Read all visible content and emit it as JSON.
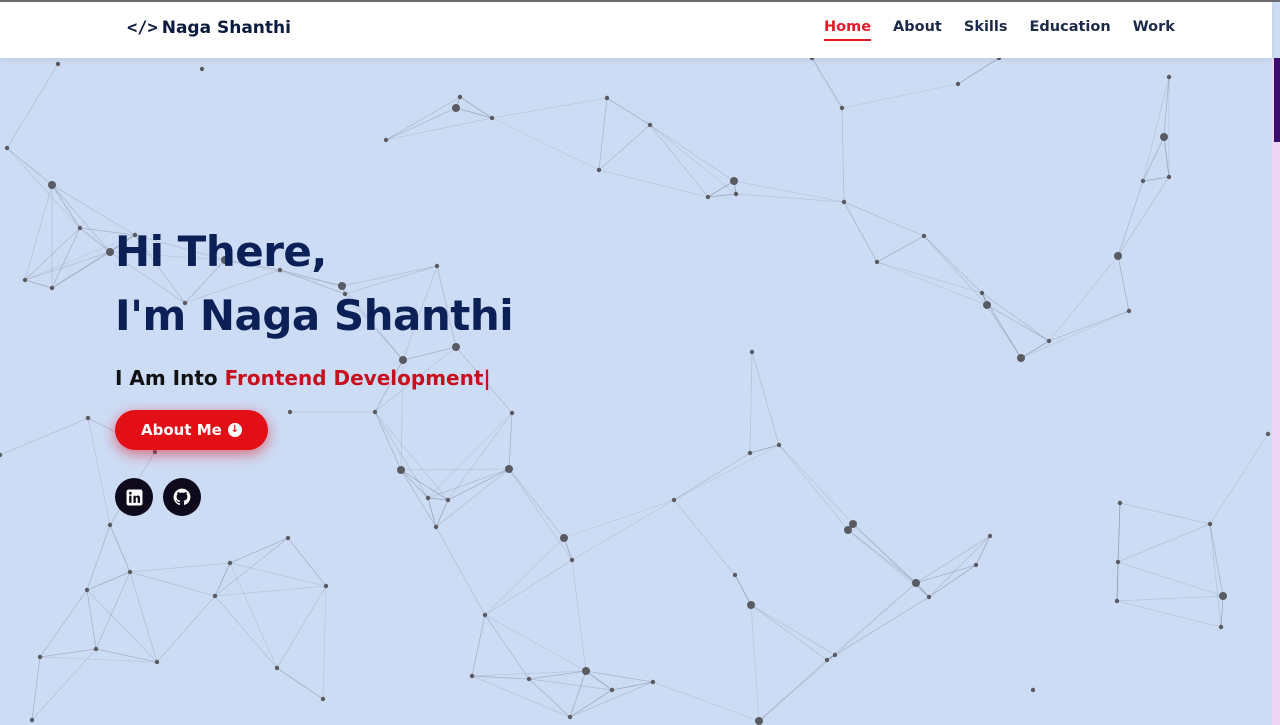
{
  "header": {
    "logo_icon": "</>",
    "logo_text": "Naga Shanthi",
    "nav": [
      {
        "label": "Home",
        "active": true
      },
      {
        "label": "About",
        "active": false
      },
      {
        "label": "Skills",
        "active": false
      },
      {
        "label": "Education",
        "active": false
      },
      {
        "label": "Work",
        "active": false
      }
    ]
  },
  "hero": {
    "greeting": "Hi There,",
    "intro": "I'm Naga Shanthi",
    "tagline_prefix": "I Am Into ",
    "tagline_typed": "Frontend Development|",
    "button_label": "About Me",
    "socials": [
      {
        "name": "linkedin-icon"
      },
      {
        "name": "github-icon"
      }
    ]
  },
  "colors": {
    "background": "#cddcf5",
    "heading": "#0b2057",
    "accent": "#e30f17",
    "nav_active": "#e41c2a"
  }
}
